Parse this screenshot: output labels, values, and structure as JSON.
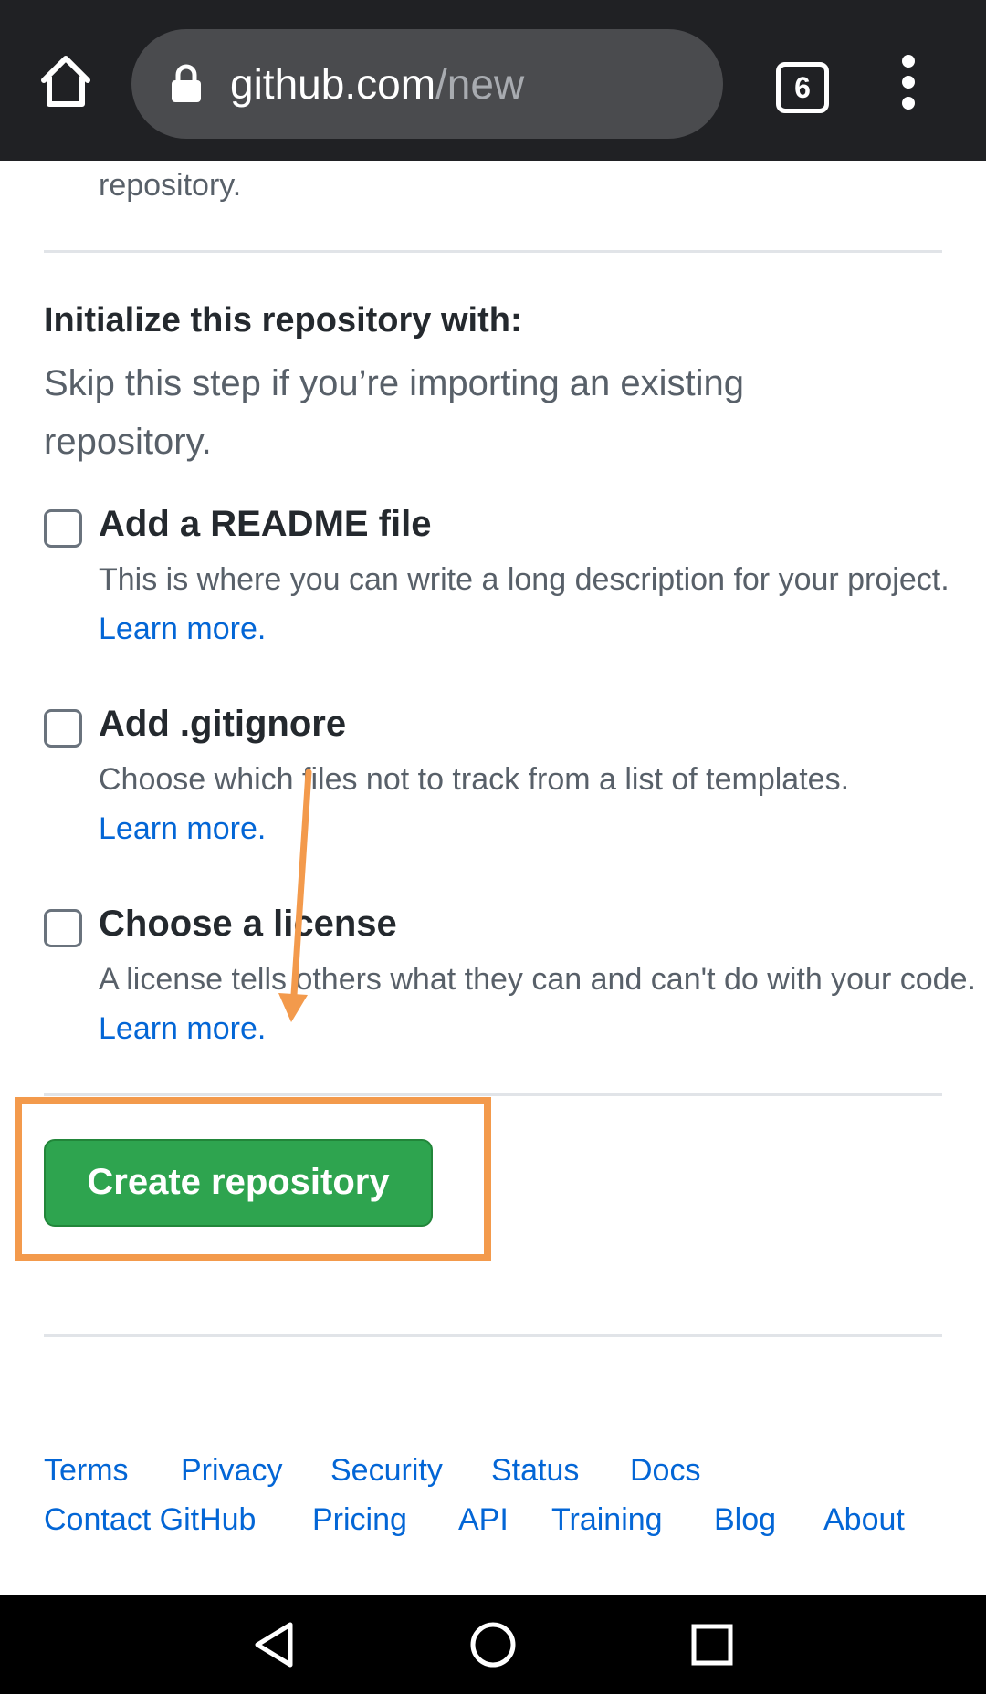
{
  "browser": {
    "url_host": "github.com",
    "url_path": "/new",
    "tab_count": "6"
  },
  "content": {
    "prev_fragment": "repository.",
    "init_title": "Initialize this repository with:",
    "init_subtitle": "Skip this step if you’re importing an existing repository.",
    "options": [
      {
        "title": "Add a README file",
        "description": "This is where you can write a long description for your project.",
        "link": "Learn more."
      },
      {
        "title": "Add .gitignore",
        "description": "Choose which files not to track from a list of templates.",
        "link": "Learn more."
      },
      {
        "title": "Choose a license",
        "description": "A license tells others what they can and can't do with your code.",
        "link": "Learn more."
      }
    ],
    "create_button": "Create repository"
  },
  "footer": {
    "row1": [
      "Terms",
      "Privacy",
      "Security",
      "Status",
      "Docs"
    ],
    "row2": [
      "Contact GitHub",
      "Pricing",
      "API",
      "Training",
      "Blog",
      "About"
    ]
  },
  "colors": {
    "topbar": "#202124",
    "link": "#0366d6",
    "create_button": "#2ea44f",
    "annotation": "#f39a4c"
  }
}
